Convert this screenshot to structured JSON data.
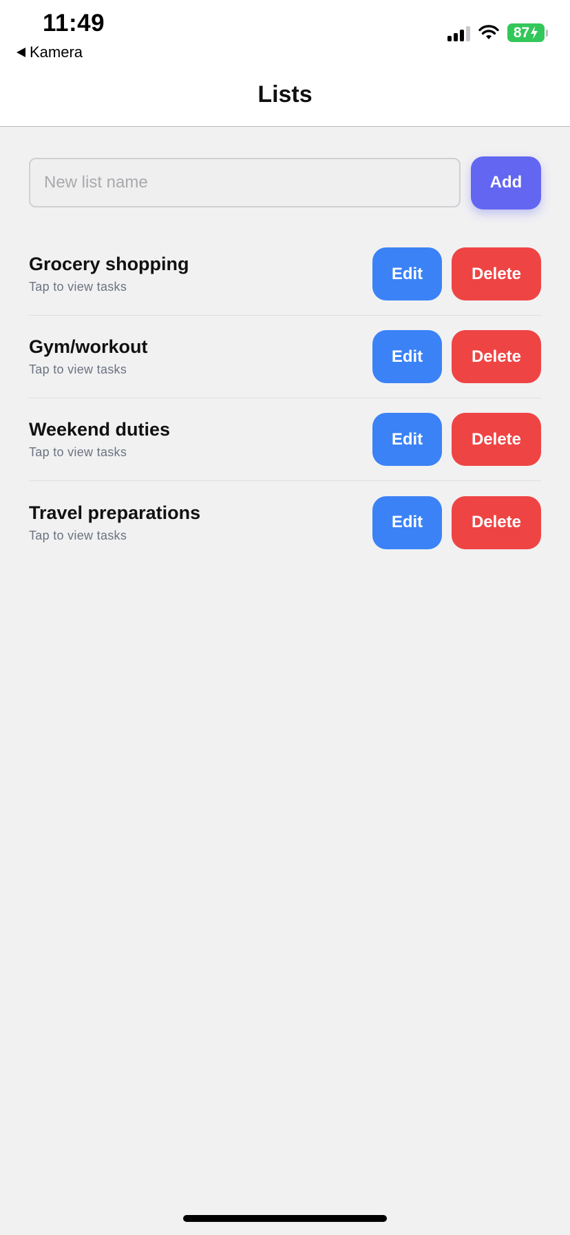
{
  "status_bar": {
    "time": "11:49",
    "back_app": "Kamera",
    "battery": "87"
  },
  "header": {
    "title": "Lists"
  },
  "new_list": {
    "placeholder": "New list name",
    "value": "",
    "add_label": "Add"
  },
  "lists": [
    {
      "name": "Grocery shopping",
      "subtitle": "Tap to view tasks",
      "edit_label": "Edit",
      "delete_label": "Delete"
    },
    {
      "name": "Gym/workout",
      "subtitle": "Tap to view tasks",
      "edit_label": "Edit",
      "delete_label": "Delete"
    },
    {
      "name": "Weekend duties",
      "subtitle": "Tap to view tasks",
      "edit_label": "Edit",
      "delete_label": "Delete"
    },
    {
      "name": "Travel preparations",
      "subtitle": "Tap to view tasks",
      "edit_label": "Edit",
      "delete_label": "Delete"
    }
  ],
  "colors": {
    "add": "#6366f1",
    "edit": "#3b82f6",
    "delete": "#ef4444",
    "battery": "#33c759",
    "background": "#f1f1f2"
  },
  "icons": {
    "back": "back-arrow-icon",
    "signal": "cellular-signal-icon",
    "wifi": "wifi-icon",
    "battery": "battery-charging-icon"
  }
}
